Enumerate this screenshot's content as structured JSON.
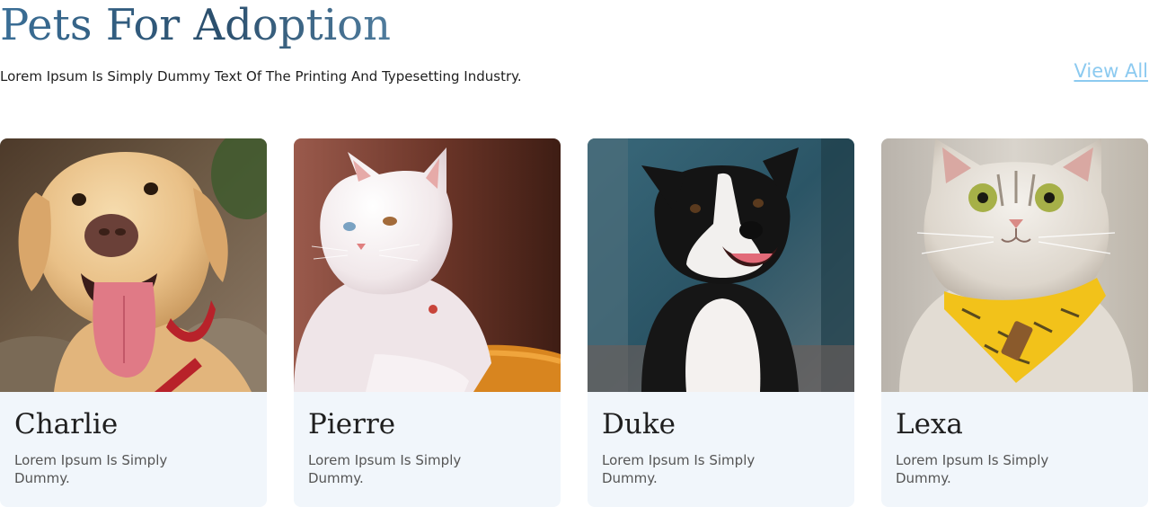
{
  "header": {
    "title": "Pets For Adoption",
    "subtitle": "Lorem Ipsum Is Simply Dummy Text Of The Printing And Typesetting Industry.",
    "view_all_label": "View All"
  },
  "pets": [
    {
      "name": "Charlie",
      "description": "Lorem Ipsum Is Simply Dummy.",
      "photo": "golden-retriever-photo"
    },
    {
      "name": "Pierre",
      "description": "Lorem Ipsum Is Simply Dummy.",
      "photo": "white-persian-cat-photo"
    },
    {
      "name": "Duke",
      "description": "Lorem Ipsum Is Simply Dummy.",
      "photo": "border-collie-photo"
    },
    {
      "name": "Lexa",
      "description": "Lorem Ipsum Is Simply Dummy.",
      "photo": "grey-cat-with-yellow-bandana-photo"
    }
  ],
  "colors": {
    "title": "#2b5378",
    "link": "#8ccaf0",
    "card_background": "#f1f6fb",
    "text": "#1f1f1f",
    "muted_text": "#555555"
  }
}
